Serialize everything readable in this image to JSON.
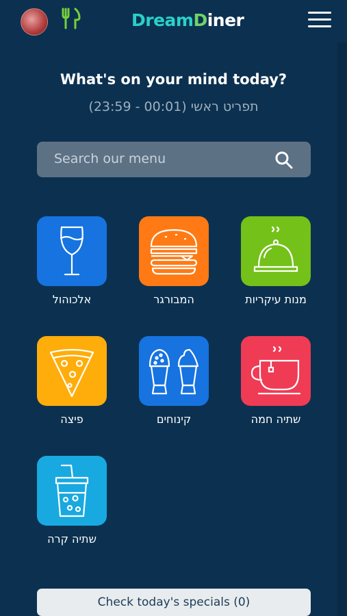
{
  "header": {
    "logo": [
      "Dream",
      "D",
      "iner"
    ],
    "avatar_icon": "avatar-photo",
    "fork_icon": "fork-knife-icon",
    "menu_icon": "hamburger-menu-icon"
  },
  "main": {
    "headline": "What's on your mind today?",
    "menu_time": "תפריט ראשי  (00:01 - 23:59)",
    "search_placeholder": "Search our menu",
    "categories": [
      {
        "label": "מנות עיקריות",
        "color": "#74c11a",
        "icon": "cloche-icon"
      },
      {
        "label": "המבורגר",
        "color": "#ff7a14",
        "icon": "burger-icon"
      },
      {
        "label": "אלכוהול",
        "color": "#1673e0",
        "icon": "wine-glass-icon"
      },
      {
        "label": "שתיה חמה",
        "color": "#f03b55",
        "icon": "coffee-cup-icon"
      },
      {
        "label": "קינוחים",
        "color": "#1673e0",
        "icon": "ice-cream-icon"
      },
      {
        "label": "פיצה",
        "color": "#ffad0a",
        "icon": "pizza-icon"
      },
      {
        "label": "שתיה קרה",
        "color": "#18a9e0",
        "icon": "cold-drink-icon"
      }
    ],
    "specials_button": "Check today's specials (0)"
  }
}
